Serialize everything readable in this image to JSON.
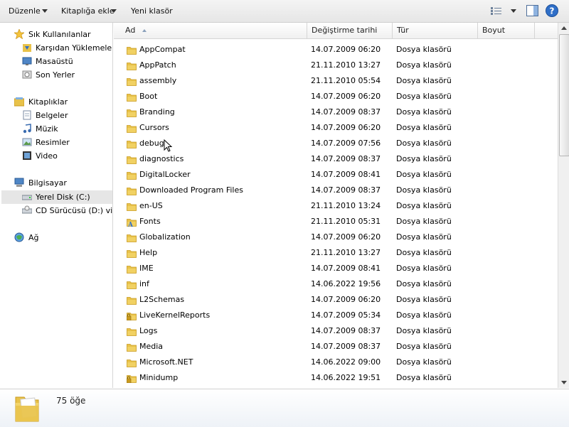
{
  "toolbar": {
    "organize_label": "Düzenle",
    "include_library_label": "Kitaplığa ekle",
    "new_folder_label": "Yeni klasör"
  },
  "nav": {
    "favorites_header": "Sık Kullanılanlar",
    "favorites": [
      "Karşıdan Yüklemeler",
      "Masaüstü",
      "Son Yerler"
    ],
    "libraries_header": "Kitaplıklar",
    "libraries": [
      "Belgeler",
      "Müzik",
      "Resimler",
      "Video"
    ],
    "computer_header": "Bilgisayar",
    "drives": [
      "Yerel Disk (C:)",
      "CD Sürücüsü (D:) virtio"
    ],
    "network_header": "Ağ"
  },
  "columns": {
    "name": "Ad",
    "modified": "Değiştirme tarihi",
    "type": "Tür",
    "size": "Boyut"
  },
  "files": [
    {
      "name": "AppCompat",
      "date": "14.07.2009 06:20",
      "type": "Dosya klasörü"
    },
    {
      "name": "AppPatch",
      "date": "21.11.2010 13:27",
      "type": "Dosya klasörü"
    },
    {
      "name": "assembly",
      "date": "21.11.2010 05:54",
      "type": "Dosya klasörü"
    },
    {
      "name": "Boot",
      "date": "14.07.2009 06:20",
      "type": "Dosya klasörü"
    },
    {
      "name": "Branding",
      "date": "14.07.2009 08:37",
      "type": "Dosya klasörü"
    },
    {
      "name": "Cursors",
      "date": "14.07.2009 06:20",
      "type": "Dosya klasörü"
    },
    {
      "name": "debug",
      "date": "14.07.2009 07:56",
      "type": "Dosya klasörü"
    },
    {
      "name": "diagnostics",
      "date": "14.07.2009 08:37",
      "type": "Dosya klasörü"
    },
    {
      "name": "DigitalLocker",
      "date": "14.07.2009 08:41",
      "type": "Dosya klasörü"
    },
    {
      "name": "Downloaded Program Files",
      "date": "14.07.2009 08:37",
      "type": "Dosya klasörü"
    },
    {
      "name": "en-US",
      "date": "21.11.2010 13:24",
      "type": "Dosya klasörü"
    },
    {
      "name": "Fonts",
      "date": "21.11.2010 05:31",
      "type": "Dosya klasörü"
    },
    {
      "name": "Globalization",
      "date": "14.07.2009 06:20",
      "type": "Dosya klasörü"
    },
    {
      "name": "Help",
      "date": "21.11.2010 13:27",
      "type": "Dosya klasörü"
    },
    {
      "name": "IME",
      "date": "14.07.2009 08:41",
      "type": "Dosya klasörü"
    },
    {
      "name": "inf",
      "date": "14.06.2022 19:56",
      "type": "Dosya klasörü"
    },
    {
      "name": "L2Schemas",
      "date": "14.07.2009 06:20",
      "type": "Dosya klasörü"
    },
    {
      "name": "LiveKernelReports",
      "date": "14.07.2009 05:34",
      "type": "Dosya klasörü"
    },
    {
      "name": "Logs",
      "date": "14.07.2009 08:37",
      "type": "Dosya klasörü"
    },
    {
      "name": "Media",
      "date": "14.07.2009 08:37",
      "type": "Dosya klasörü"
    },
    {
      "name": "Microsoft.NET",
      "date": "14.06.2022 09:00",
      "type": "Dosya klasörü"
    },
    {
      "name": "Minidump",
      "date": "14.06.2022 19:51",
      "type": "Dosya klasörü"
    }
  ],
  "status": {
    "item_count": "75 öğe"
  },
  "colors": {
    "folder": "#e8c24a",
    "folder_dark": "#c99a1f",
    "help_blue": "#2f6fc8"
  },
  "icons": [
    "view-options-icon",
    "preview-pane-icon",
    "help-icon",
    "star-icon",
    "library-icon",
    "computer-icon",
    "network-icon",
    "folder-icon",
    "lock-icon",
    "fonts-icon"
  ]
}
